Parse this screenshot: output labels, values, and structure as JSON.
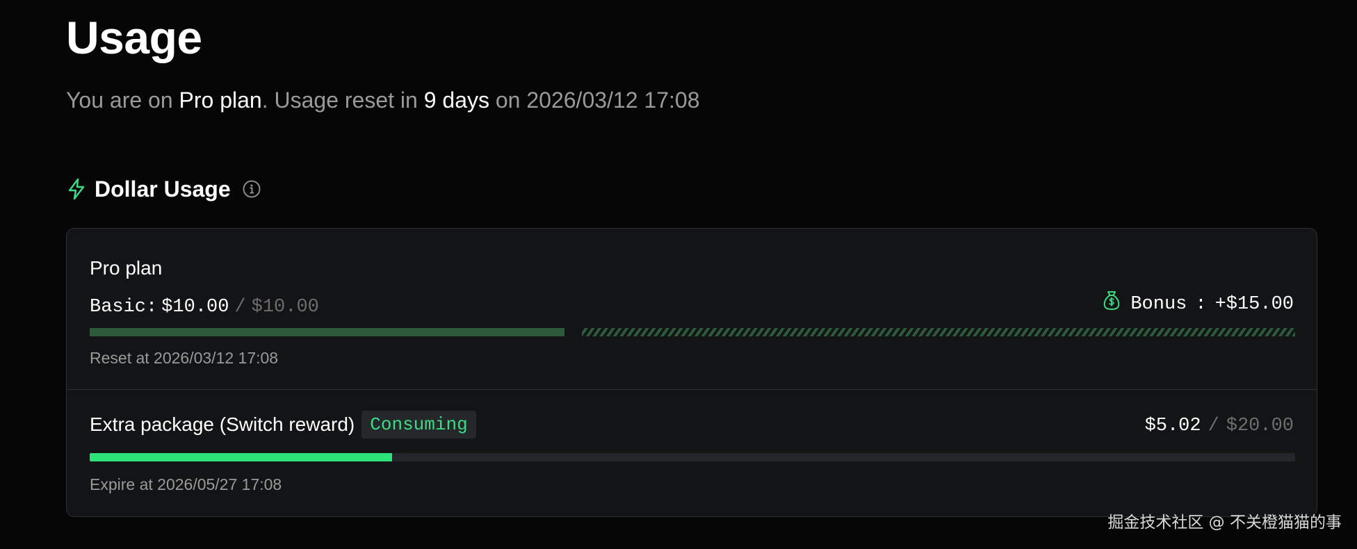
{
  "header": {
    "title": "Usage",
    "subtitle": {
      "prefix": "You are on ",
      "plan": "Pro plan",
      "mid": ". Usage reset in ",
      "days": "9 days",
      "suffix": " on 2026/03/12 17:08"
    }
  },
  "dollar_usage": {
    "title": "Dollar Usage",
    "icon": "bolt-icon",
    "info_icon": "info-icon",
    "accent_color": "#3ddc84"
  },
  "pro_plan": {
    "name": "Pro plan",
    "basic_label": "Basic:",
    "basic_used": "$10.00",
    "separator": "/",
    "basic_total": "$10.00",
    "basic_progress": 1.0,
    "bonus_icon": "moneybag-icon",
    "bonus_label": "Bonus",
    "bonus_colon": ":",
    "bonus_value": "+$15.00",
    "reset_text": "Reset at 2026/03/12 17:08",
    "bar_color": "#2d5a3b"
  },
  "extra_package": {
    "name": "Extra package (Switch reward)",
    "status": "Consuming",
    "used": "$5.02",
    "separator": "/",
    "total": "$20.00",
    "progress": 0.251,
    "expire_text": "Expire at 2026/05/27 17:08",
    "bar_color": "#2ee27a"
  },
  "watermark": "掘金技术社区 @ 不关橙猫猫的事"
}
